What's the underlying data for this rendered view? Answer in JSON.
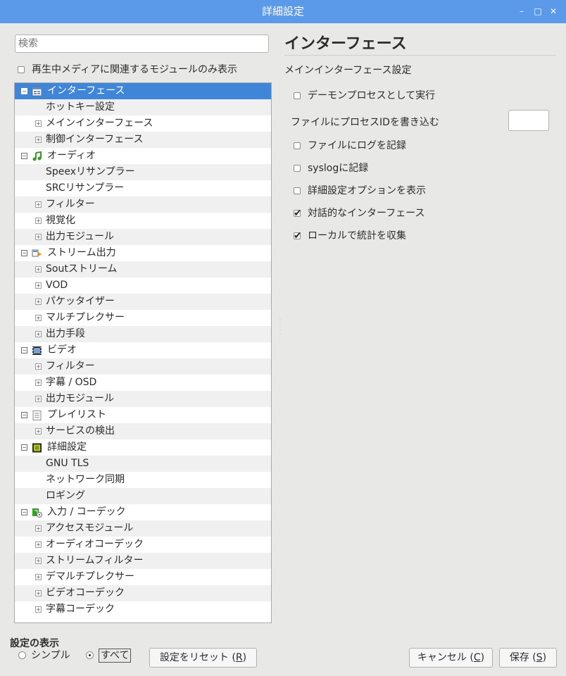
{
  "window": {
    "title": "詳細設定"
  },
  "search": {
    "placeholder": "検索"
  },
  "filter_only_playing": {
    "label": "再生中メディアに関連するモジュールのみ表示",
    "checked": false
  },
  "tree": [
    {
      "label": "インターフェース",
      "level": 0,
      "expand": "-",
      "icon": "interface-icon",
      "selected": true
    },
    {
      "label": "ホットキー設定",
      "level": 1,
      "expand": ""
    },
    {
      "label": "メインインターフェース",
      "level": 1,
      "expand": "+"
    },
    {
      "label": "制御インターフェース",
      "level": 1,
      "expand": "+"
    },
    {
      "label": "オーディオ",
      "level": 0,
      "expand": "-",
      "icon": "audio-icon"
    },
    {
      "label": "Speexリサンプラー",
      "level": 1,
      "expand": ""
    },
    {
      "label": "SRCリサンプラー",
      "level": 1,
      "expand": ""
    },
    {
      "label": "フィルター",
      "level": 1,
      "expand": "+"
    },
    {
      "label": "視覚化",
      "level": 1,
      "expand": "+"
    },
    {
      "label": "出力モジュール",
      "level": 1,
      "expand": "+"
    },
    {
      "label": "ストリーム出力",
      "level": 0,
      "expand": "-",
      "icon": "stream-output-icon"
    },
    {
      "label": "Soutストリーム",
      "level": 1,
      "expand": "+"
    },
    {
      "label": "VOD",
      "level": 1,
      "expand": "+"
    },
    {
      "label": "パケッタイザー",
      "level": 1,
      "expand": "+"
    },
    {
      "label": "マルチプレクサー",
      "level": 1,
      "expand": "+"
    },
    {
      "label": "出力手段",
      "level": 1,
      "expand": "+"
    },
    {
      "label": "ビデオ",
      "level": 0,
      "expand": "-",
      "icon": "video-icon"
    },
    {
      "label": "フィルター",
      "level": 1,
      "expand": "+"
    },
    {
      "label": "字幕 / OSD",
      "level": 1,
      "expand": "+"
    },
    {
      "label": "出力モジュール",
      "level": 1,
      "expand": "+"
    },
    {
      "label": "プレイリスト",
      "level": 0,
      "expand": "-",
      "icon": "playlist-icon"
    },
    {
      "label": "サービスの検出",
      "level": 1,
      "expand": "+"
    },
    {
      "label": "詳細設定",
      "level": 0,
      "expand": "-",
      "icon": "advanced-icon"
    },
    {
      "label": "GNU TLS",
      "level": 1,
      "expand": ""
    },
    {
      "label": "ネットワーク同期",
      "level": 1,
      "expand": ""
    },
    {
      "label": "ロギング",
      "level": 1,
      "expand": ""
    },
    {
      "label": "入力 / コーデック",
      "level": 0,
      "expand": "-",
      "icon": "input-codec-icon"
    },
    {
      "label": "アクセスモジュール",
      "level": 1,
      "expand": "+"
    },
    {
      "label": "オーディオコーデック",
      "level": 1,
      "expand": "+"
    },
    {
      "label": "ストリームフィルター",
      "level": 1,
      "expand": "+"
    },
    {
      "label": "デマルチプレクサー",
      "level": 1,
      "expand": "+"
    },
    {
      "label": "ビデオコーデック",
      "level": 1,
      "expand": "+"
    },
    {
      "label": "字幕コーデック",
      "level": 1,
      "expand": "+"
    }
  ],
  "panel": {
    "title": "インターフェース",
    "subtitle": "メインインターフェース設定",
    "daemon": {
      "label": "デーモンプロセスとして実行",
      "checked": false
    },
    "pid_label": "ファイルにプロセスIDを書き込む",
    "pid_value": "",
    "log_file": {
      "label": "ファイルにログを記録",
      "checked": false
    },
    "syslog": {
      "label": "syslogに記録",
      "checked": false
    },
    "advanced_options": {
      "label": "詳細設定オプションを表示",
      "checked": false
    },
    "interactive": {
      "label": "対話的なインターフェース",
      "checked": true
    },
    "stats": {
      "label": "ローカルで統計を収集",
      "checked": true
    }
  },
  "footer": {
    "show_settings": "設定の表示",
    "simple": "シンプル",
    "all": "すべて",
    "reset": "設定をリセット",
    "reset_key": "R",
    "cancel": "キャンセル",
    "cancel_key": "C",
    "save": "保存",
    "save_key": "S"
  }
}
